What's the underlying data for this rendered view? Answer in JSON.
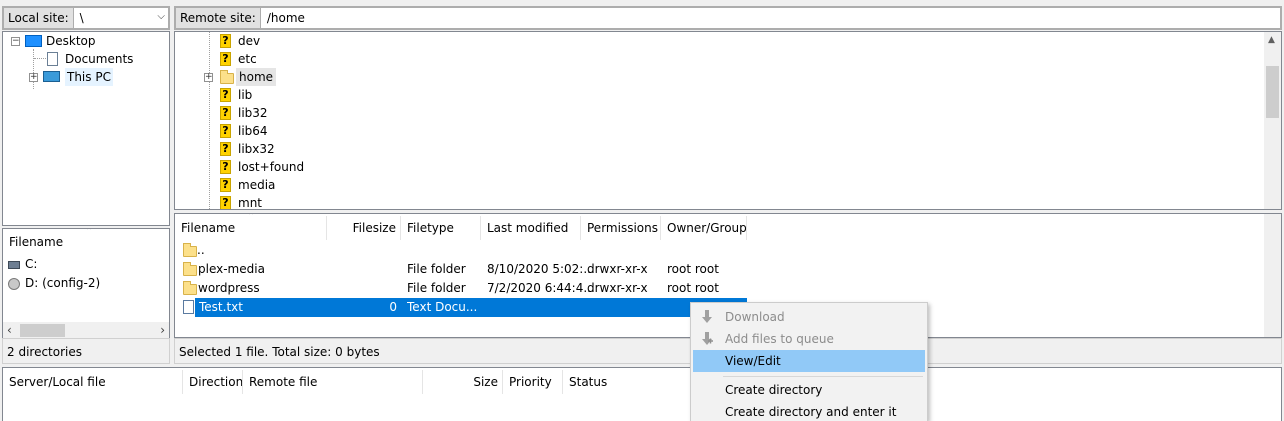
{
  "local_site": {
    "label": "Local site:",
    "path": "\\"
  },
  "remote_site": {
    "label": "Remote site:",
    "path": "/home"
  },
  "local_tree": {
    "items": [
      {
        "label": "Desktop"
      },
      {
        "label": "Documents"
      },
      {
        "label": "This PC"
      }
    ]
  },
  "remote_tree": {
    "items": [
      {
        "label": "dev"
      },
      {
        "label": "etc"
      },
      {
        "label": "home"
      },
      {
        "label": "lib"
      },
      {
        "label": "lib32"
      },
      {
        "label": "lib64"
      },
      {
        "label": "libx32"
      },
      {
        "label": "lost+found"
      },
      {
        "label": "media"
      },
      {
        "label": "mnt"
      }
    ]
  },
  "local_list": {
    "header": "Filename",
    "rows": [
      {
        "name": "C:"
      },
      {
        "name": "D: (config-2)"
      }
    ],
    "status": "2 directories"
  },
  "remote_list": {
    "headers": [
      "Filename",
      "Filesize",
      "Filetype",
      "Last modified",
      "Permissions",
      "Owner/Group"
    ],
    "rows": [
      {
        "name": "..",
        "size": "",
        "type": "",
        "modified": "",
        "perms": "",
        "owner": ""
      },
      {
        "name": "plex-media",
        "size": "",
        "type": "File folder",
        "modified": "8/10/2020 5:02:...",
        "perms": "drwxr-xr-x",
        "owner": "root root"
      },
      {
        "name": "wordpress",
        "size": "",
        "type": "File folder",
        "modified": "7/2/2020 6:44:4...",
        "perms": "drwxr-xr-x",
        "owner": "root root"
      },
      {
        "name": "Test.txt",
        "size": "0",
        "type": "Text Docu...",
        "modified": "",
        "perms": "",
        "owner": ""
      }
    ],
    "status": "Selected 1 file. Total size: 0 bytes"
  },
  "queue": {
    "headers": [
      "Server/Local file",
      "Direction",
      "Remote file",
      "Size",
      "Priority",
      "Status"
    ]
  },
  "context_menu": {
    "items": [
      {
        "label": "Download"
      },
      {
        "label": "Add files to queue"
      },
      {
        "label": "View/Edit"
      },
      {
        "label": "Create directory"
      },
      {
        "label": "Create directory and enter it"
      }
    ]
  },
  "colors": {
    "selection": "#0078d7",
    "menu_highlight": "#91c9f7",
    "question_icon": "#ffd200"
  }
}
